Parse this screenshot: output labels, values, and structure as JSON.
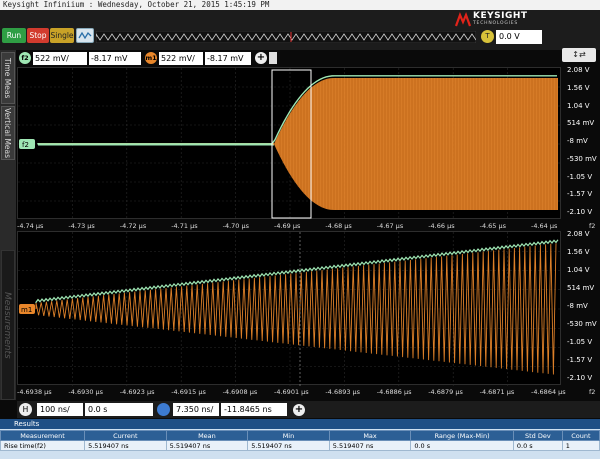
{
  "app": {
    "title": "Keysight Infiniium : Wednesday, October 21, 2015 1:45:19 PM"
  },
  "toolbar": {
    "run_label": "Run",
    "stop_label": "Stop",
    "single_label": "Single",
    "trigger_badge": "T",
    "trigger_level": "0.0 V",
    "logo_main": "KEYSIGHT",
    "logo_sub": "TECHNOLOGIES"
  },
  "sidebar": {
    "tab_time_meas": "Time Meas",
    "tab_vertical_meas": "Vertical Meas",
    "tab_measurements": "Measurements"
  },
  "channel_bar": {
    "f2_badge": "f2",
    "f2_scale": "522 mV/",
    "f2_offset": "-8.17 mV",
    "m1_badge": "m1",
    "m1_scale": "522 mV/",
    "m1_offset": "-8.17 mV"
  },
  "upper_plot": {
    "marker_label": "f2",
    "y_ticks": [
      "2.08 V",
      "1.56 V",
      "1.04 V",
      "514 mV",
      "-8 mV",
      "-530 mV",
      "-1.05 V",
      "-1.57 V",
      "-2.10 V"
    ],
    "x_ticks": [
      "-4.74 µs",
      "-4.73 µs",
      "-4.72 µs",
      "-4.71 µs",
      "-4.70 µs",
      "-4.69 µs",
      "-4.68 µs",
      "-4.67 µs",
      "-4.66 µs",
      "-4.65 µs",
      "-4.64 µs"
    ],
    "x_suffix": "f2"
  },
  "lower_plot": {
    "marker_label": "m1",
    "y_ticks": [
      "2.08 V",
      "1.56 V",
      "1.04 V",
      "514 mV",
      "-8 mV",
      "-530 mV",
      "-1.05 V",
      "-1.57 V",
      "-2.10 V"
    ],
    "x_ticks": [
      "-4.6938 µs",
      "-4.6930 µs",
      "-4.6923 µs",
      "-4.6915 µs",
      "-4.6908 µs",
      "-4.6901 µs",
      "-4.6893 µs",
      "-4.6886 µs",
      "-4.6879 µs",
      "-4.6871 µs",
      "-4.6864 µs"
    ],
    "x_suffix": "f2"
  },
  "horizontal": {
    "badge": "H",
    "main_scale": "100 ns/",
    "main_pos": "0.0 s",
    "zoom_scale": "7.350 ns/",
    "zoom_pos": "-11.8465 ns"
  },
  "results": {
    "title": "Results",
    "columns": [
      "Measurement",
      "Current",
      "Mean",
      "Min",
      "Max",
      "Range (Max-Min)",
      "Std Dev",
      "Count"
    ],
    "rows": [
      [
        "Rise time(f2)",
        "5.519407 ns",
        "5.519407 ns",
        "5.519407 ns",
        "5.519407 ns",
        "0.0 s",
        "0.0 s",
        "1"
      ]
    ]
  },
  "colors": {
    "trace_orange": "#e8862a",
    "envelope_green": "#9fe7b4",
    "run_green": "#2f9e44",
    "stop_red": "#d23b2e"
  }
}
